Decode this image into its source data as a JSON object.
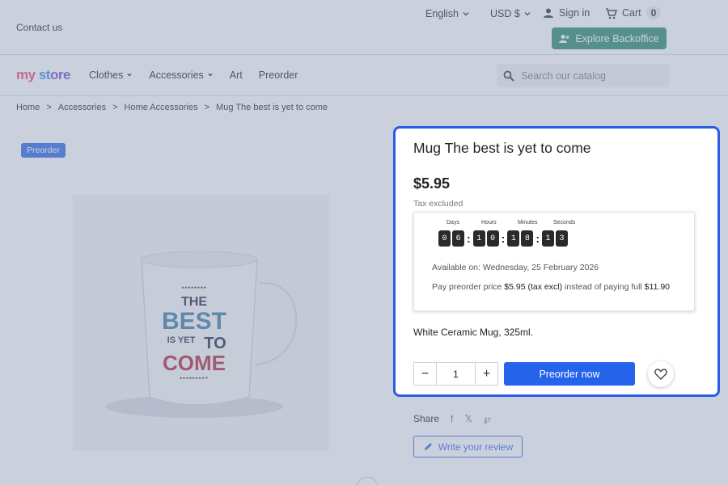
{
  "header": {
    "contact": "Contact us",
    "language": "English",
    "currency": "USD $",
    "signin": "Sign in",
    "cart_label": "Cart",
    "cart_count": "0",
    "backoffice": "Explore Backoffice"
  },
  "nav": {
    "logo": [
      "my",
      " ",
      "st",
      "ore"
    ],
    "menu": [
      "Clothes",
      "Accessories",
      "Art",
      "Preorder"
    ],
    "search_placeholder": "Search our catalog"
  },
  "breadcrumb": [
    "Home",
    "Accessories",
    "Home Accessories",
    "Mug The best is yet to come"
  ],
  "product": {
    "badge": "Preorder",
    "title": "Mug The best is yet to come",
    "price": "$5.95",
    "tax_note": "Tax excluded",
    "mug_text": [
      "THE",
      "BEST",
      "IS YET",
      "TO",
      "COME"
    ],
    "countdown": {
      "labels": [
        "Days",
        "Hours",
        "Minutes",
        "Seconds"
      ],
      "days": [
        "0",
        "6"
      ],
      "hours": [
        "1",
        "0"
      ],
      "minutes": [
        "1",
        "8"
      ],
      "seconds": [
        "1",
        "3"
      ]
    },
    "available": "Available on: Wednesday, 25 February 2026",
    "pay_prefix": "Pay preorder price",
    "pay_price": "$5.95 (tax excl)",
    "pay_middle": "instead of paying full",
    "full_price": "$11.90",
    "description": "White Ceramic Mug, 325ml.",
    "quantity": "1",
    "preorder_button": "Preorder now",
    "share_label": "Share",
    "review_button": "Write your review"
  },
  "colors": {
    "accent": "#2563eb",
    "highlight_border": "#2b5ce6",
    "backoffice": "#2b8a6c"
  }
}
